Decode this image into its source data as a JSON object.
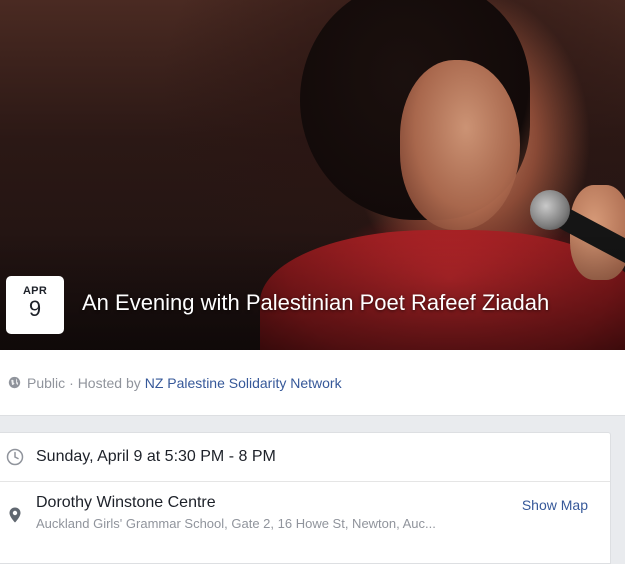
{
  "event": {
    "month": "APR",
    "day": "9",
    "title": "An Evening with Palestinian Poet Rafeef Ziadah"
  },
  "privacy": {
    "icon": "globe-icon",
    "label": "Public",
    "hosted_prefix": "· Hosted by",
    "host_name": "NZ Palestine Solidarity Network"
  },
  "details": {
    "time": {
      "icon": "clock-icon",
      "text": "Sunday, April 9 at 5:30 PM - 8 PM"
    },
    "location": {
      "icon": "map-pin-icon",
      "name": "Dorothy Winstone Centre",
      "address": "Auckland Girls' Grammar School, Gate 2, 16 Howe St, Newton, Auc...",
      "show_map_label": "Show Map"
    }
  },
  "colors": {
    "link": "#365899",
    "muted": "#90949c",
    "background": "#e9ebee"
  }
}
